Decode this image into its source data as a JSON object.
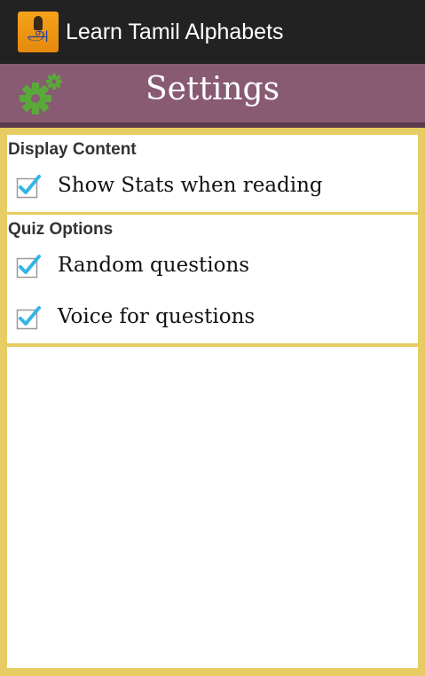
{
  "app": {
    "title": "Learn Tamil Alphabets",
    "icon": "app-logo-icon",
    "icon_glyph": "அ"
  },
  "header": {
    "title": "Settings",
    "icon": "gear-icon",
    "bg_color": "#885b73"
  },
  "colors": {
    "frame": "#e6cc62",
    "checkbox_check": "#33b5e5"
  },
  "sections": [
    {
      "title": "Display Content",
      "items": [
        {
          "label": "Show Stats when reading",
          "checked": true
        }
      ]
    },
    {
      "title": "Quiz Options",
      "items": [
        {
          "label": "Random questions",
          "checked": true
        },
        {
          "label": "Voice for questions",
          "checked": true
        }
      ]
    }
  ]
}
